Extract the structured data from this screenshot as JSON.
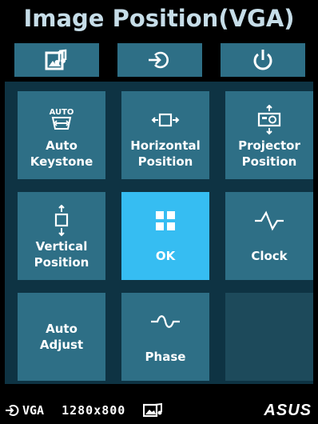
{
  "title": "Image Position(VGA)",
  "top_tabs": [
    {
      "icon": "image-settings-icon"
    },
    {
      "icon": "input-source-icon"
    },
    {
      "icon": "power-icon"
    }
  ],
  "tiles": [
    {
      "label": "Auto\nKeystone",
      "icon": "auto-keystone-icon",
      "icon_text": "AUTO"
    },
    {
      "label": "Horizontal\nPosition",
      "icon": "horizontal-position-icon"
    },
    {
      "label": "Projector\nPosition",
      "icon": "projector-position-icon"
    },
    {
      "label": "Vertical\nPosition",
      "icon": "vertical-position-icon"
    },
    {
      "label": "OK",
      "icon": "ok-grid-icon",
      "selected": true
    },
    {
      "label": "Clock",
      "icon": "clock-wave-icon"
    },
    {
      "label": "Auto\nAdjust"
    },
    {
      "label": "Phase",
      "icon": "phase-wave-icon"
    },
    {
      "label": ""
    }
  ],
  "status": {
    "source": "VGA",
    "resolution": "1280x800",
    "brand": "ASUS"
  },
  "colors": {
    "tile": "#2e6f86",
    "selected": "#36bdf2",
    "panel": "#0e3343",
    "title": "#c6dde8"
  }
}
